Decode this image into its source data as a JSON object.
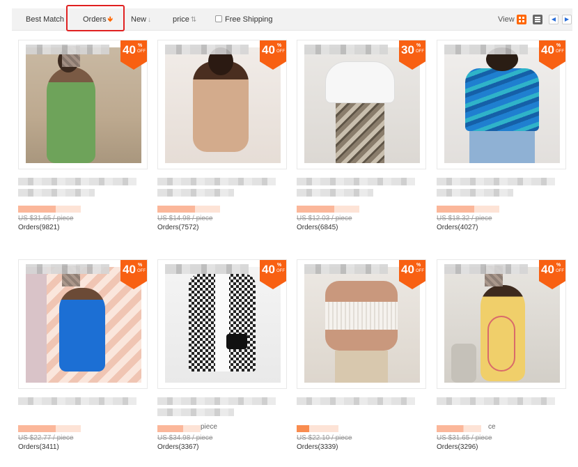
{
  "sort": {
    "best_match": "Best Match",
    "orders": "Orders",
    "new": "New",
    "price": "price",
    "free_shipping": "Free Shipping",
    "view": "View"
  },
  "colors": {
    "accent": "#f86012",
    "highlight_box": "#e02020"
  },
  "icons": [
    "sort-down-arrow-icon",
    "grid-view-icon",
    "list-view-icon",
    "prev-page-icon",
    "next-page-icon"
  ],
  "products": [
    {
      "discount": "40",
      "orig_price": "US $31.65 / piece",
      "orders": "Orders(9821)",
      "price_tail": ""
    },
    {
      "discount": "40",
      "orig_price": "US $14.98 / piece",
      "orders": "Orders(7572)",
      "price_tail": ""
    },
    {
      "discount": "30",
      "orig_price": "US $12.03 / piece",
      "orders": "Orders(6845)",
      "price_tail": ""
    },
    {
      "discount": "40",
      "orig_price": "US $18.32 / piece",
      "orders": "Orders(4027)",
      "price_tail": ""
    },
    {
      "discount": "40",
      "orig_price": "US $22.77 / piece",
      "orders": "Orders(3411)",
      "price_tail": ""
    },
    {
      "discount": "40",
      "orig_price": "US $34.98 / piece",
      "orders": "Orders(3367)",
      "price_tail": "piece"
    },
    {
      "discount": "40",
      "orig_price": "US $22.10 / piece",
      "orders": "Orders(3339)",
      "price_tail": ""
    },
    {
      "discount": "40",
      "orig_price": "US $31.65 / piece",
      "orders": "Orders(3296)",
      "price_tail": "ce"
    }
  ]
}
